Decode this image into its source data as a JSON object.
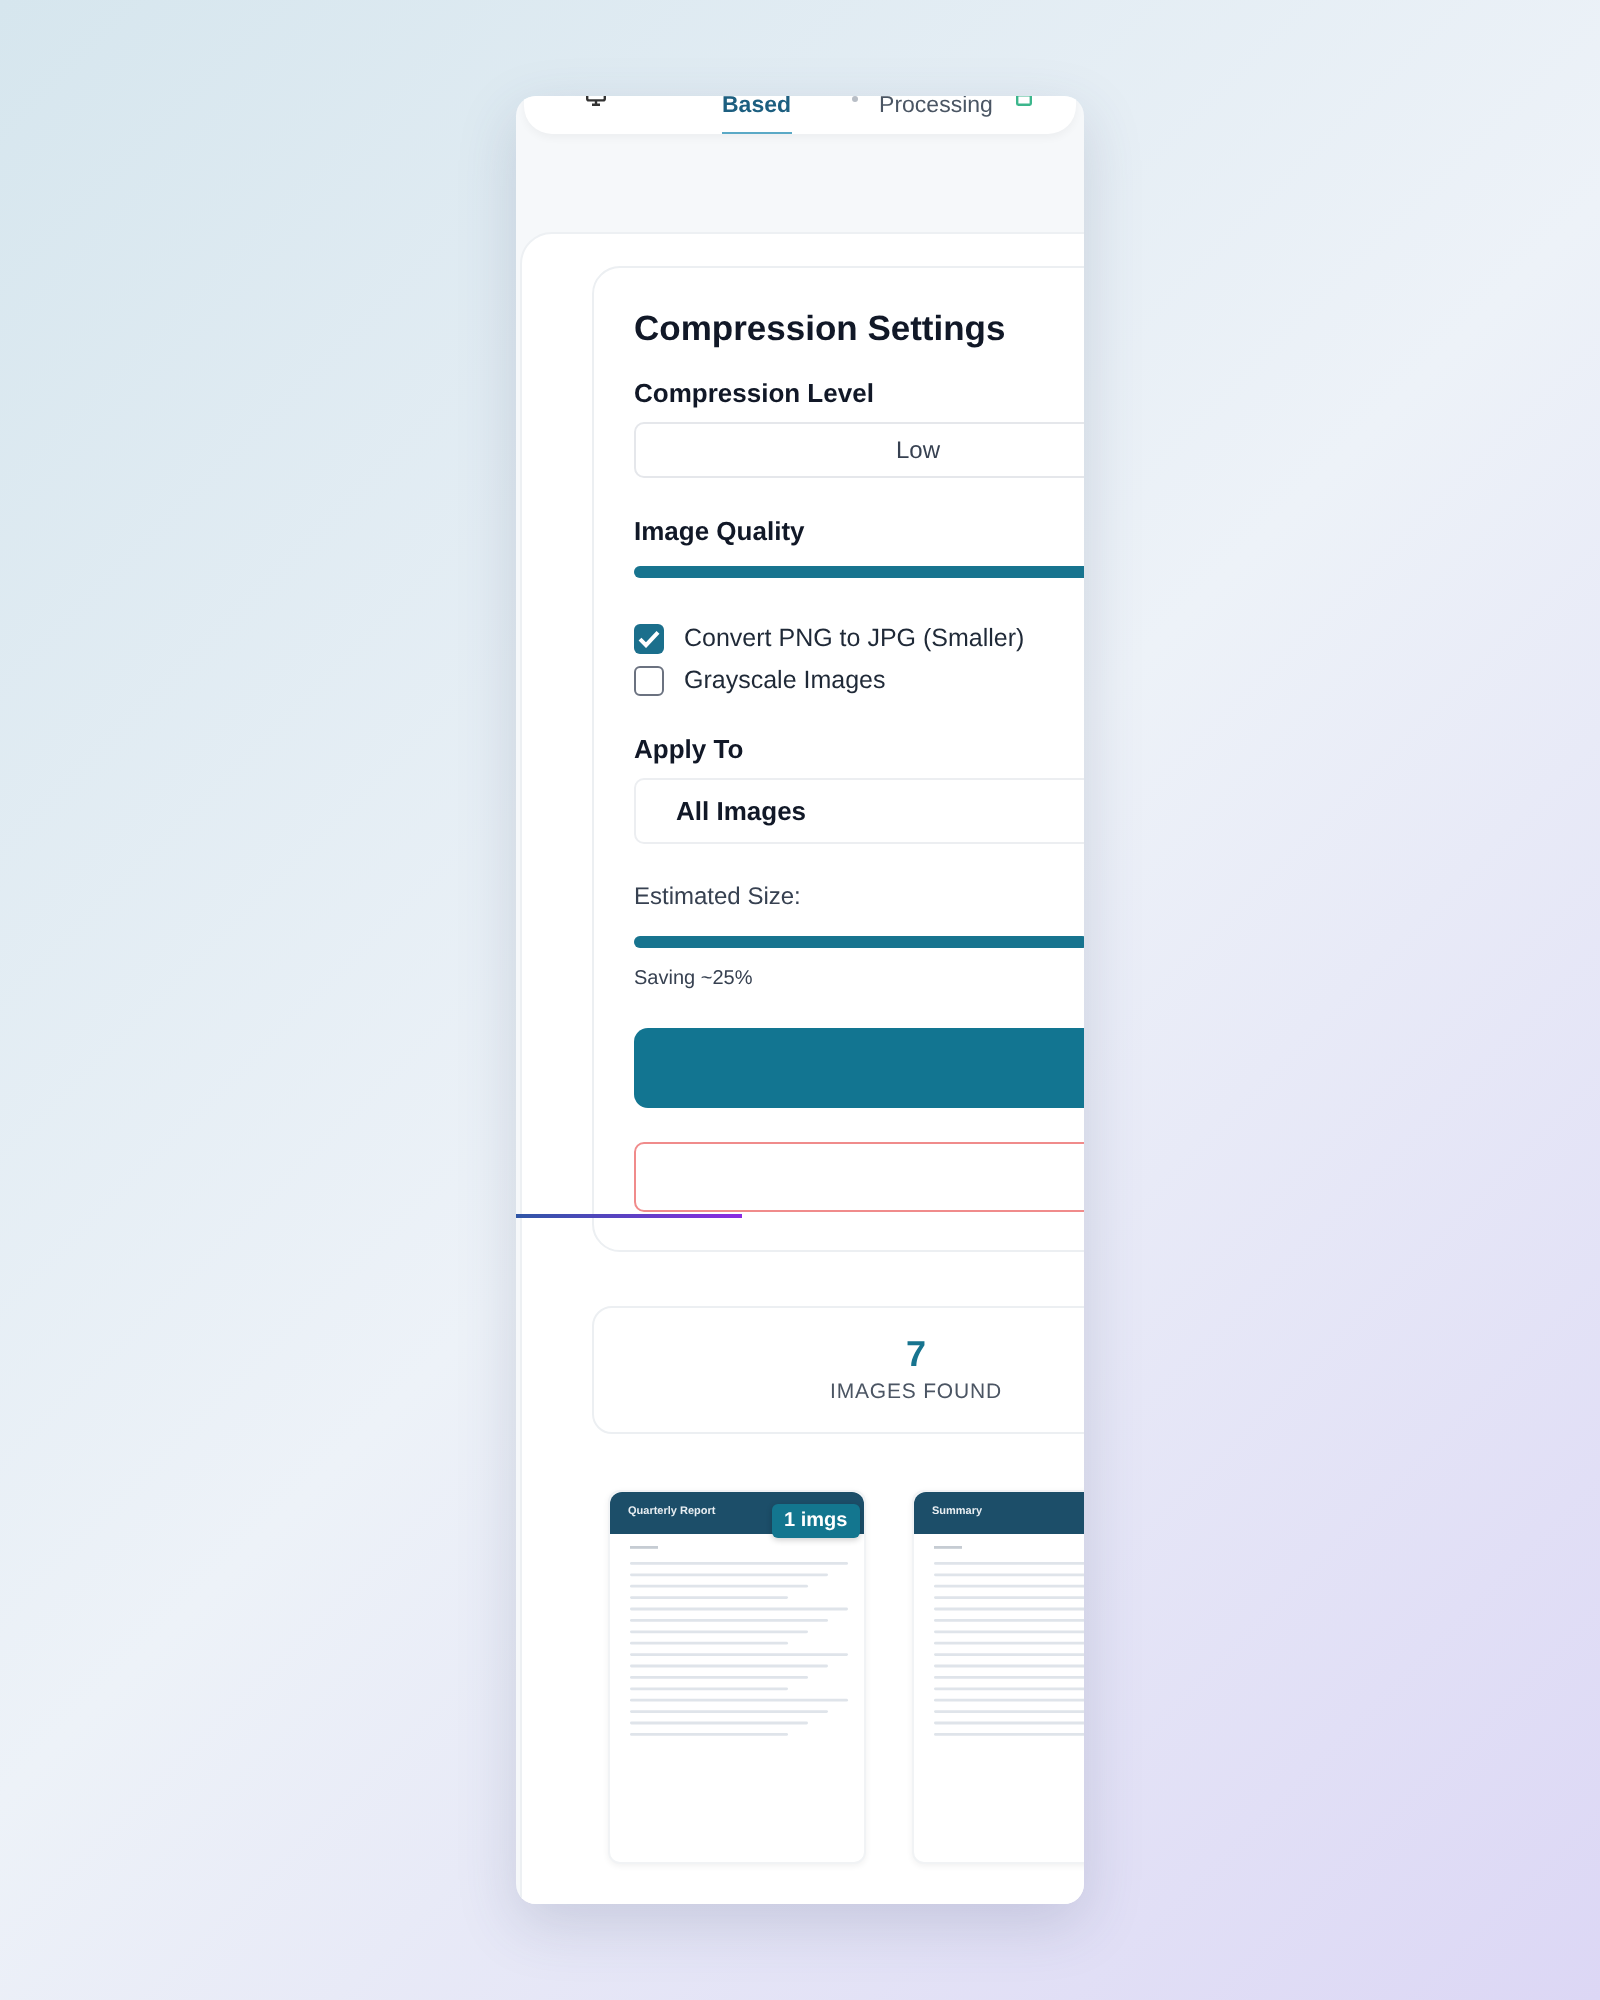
{
  "tabs": [
    {
      "label": "Based",
      "selected": true
    },
    {
      "label": "Processing",
      "selected": false
    }
  ],
  "settings": {
    "title": "Compression Settings",
    "compression_level": {
      "label": "Compression Level",
      "value": "Low"
    },
    "image_quality": {
      "label": "Image Quality",
      "level": 0.85
    },
    "options": [
      {
        "label": "Convert PNG to JPG (Smaller)",
        "checked": true
      },
      {
        "label": "Grayscale Images",
        "checked": false
      }
    ],
    "apply_to": {
      "label": "Apply To",
      "value": "All Images"
    },
    "estimate": {
      "label": "Estimated Size:",
      "level": 0.8,
      "saving": "Saving ~25%"
    }
  },
  "stats": {
    "count": "7",
    "label": "IMAGES FOUND"
  },
  "pages": [
    {
      "title": "Quarterly Report",
      "badge": "1 imgs"
    },
    {
      "title": "Summary"
    }
  ]
}
